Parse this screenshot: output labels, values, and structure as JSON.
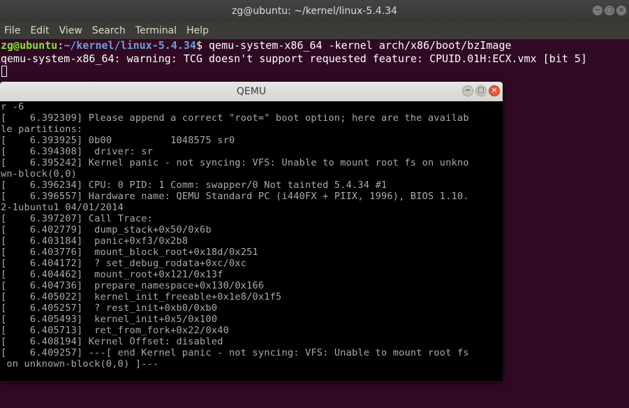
{
  "terminal": {
    "title": "zg@ubuntu: ~/kernel/linux-5.4.34",
    "controls": {
      "minimize": "−",
      "maximize": "□",
      "close": "×"
    },
    "menu": [
      "File",
      "Edit",
      "View",
      "Search",
      "Terminal",
      "Help"
    ],
    "prompt_user": "zg@ubuntu",
    "prompt_sep": ":",
    "prompt_path": "~/kernel/linux-5.4.34",
    "prompt_symbol": "$ ",
    "command": "qemu-system-x86_64 -kernel arch/x86/boot/bzImage",
    "output_line": "qemu-system-x86_64: warning: TCG doesn't support requested feature: CPUID.01H:ECX.vmx [bit 5]"
  },
  "qemu": {
    "title": "QEMU",
    "controls": {
      "minimize": "−",
      "maximize": "□",
      "close": "×"
    },
    "console_lines": [
      "r -6",
      "[    6.392309] Please append a correct \"root=\" boot option; here are the availab",
      "le partitions:",
      "[    6.393925] 0b00          1048575 sr0",
      "[    6.394308]  driver: sr",
      "[    6.395242] Kernel panic - not syncing: VFS: Unable to mount root fs on unkno",
      "wn-block(0,0)",
      "[    6.396234] CPU: 0 PID: 1 Comm: swapper/0 Not tainted 5.4.34 #1",
      "[    6.396557] Hardware name: QEMU Standard PC (i440FX + PIIX, 1996), BIOS 1.10.",
      "2-1ubuntu1 04/01/2014",
      "[    6.397207] Call Trace:",
      "[    6.402779]  dump_stack+0x50/0x6b",
      "[    6.403184]  panic+0xf3/0x2b8",
      "[    6.403776]  mount_block_root+0x18d/0x251",
      "[    6.404172]  ? set_debug_rodata+0xc/0xc",
      "[    6.404462]  mount_root+0x121/0x13f",
      "[    6.404736]  prepare_namespace+0x130/0x166",
      "[    6.405022]  kernel_init_freeable+0x1e8/0x1f5",
      "[    6.405257]  ? rest_init+0xb0/0xb0",
      "[    6.405493]  kernel_init+0x5/0x100",
      "[    6.405713]  ret_from_fork+0x22/0x40",
      "[    6.408194] Kernel Offset: disabled",
      "[    6.409257] ---[ end Kernel panic - not syncing: VFS: Unable to mount root fs",
      " on unknown-block(0,0) ]---"
    ]
  }
}
